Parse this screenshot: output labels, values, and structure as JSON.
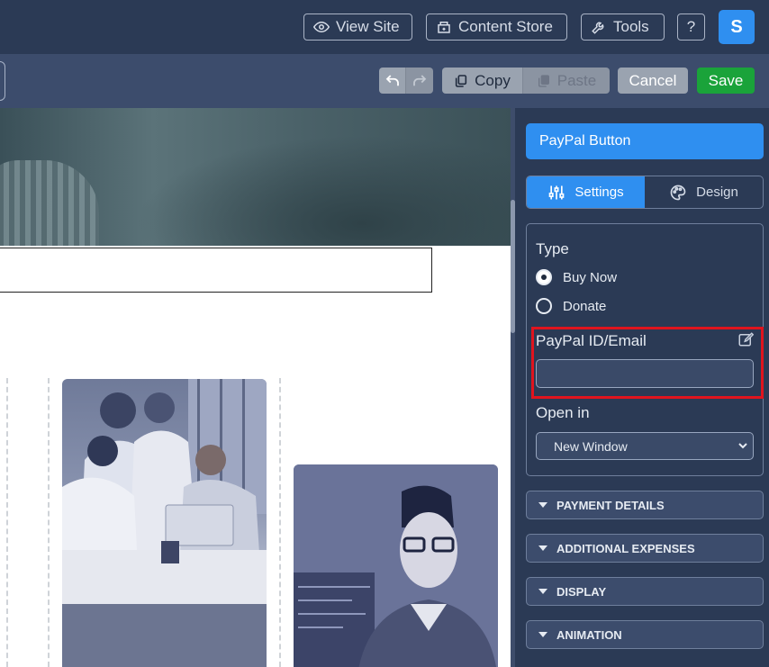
{
  "topbar": {
    "view_site": "View Site",
    "content_store": "Content Store",
    "tools": "Tools",
    "help": "?",
    "avatar_letter": "S"
  },
  "toolbar": {
    "copy": "Copy",
    "paste": "Paste",
    "cancel": "Cancel",
    "save": "Save"
  },
  "panel": {
    "title": "PayPal Button",
    "tabs": [
      "Settings",
      "Design"
    ],
    "type_label": "Type",
    "type_options": [
      "Buy Now",
      "Donate"
    ],
    "type_selected": "Buy Now",
    "paypal_label": "PayPal ID/Email",
    "paypal_value": "",
    "open_in_label": "Open in",
    "open_in_value": "New Window",
    "sections": [
      "PAYMENT DETAILS",
      "ADDITIONAL EXPENSES",
      "DISPLAY",
      "ANIMATION"
    ]
  },
  "colors": {
    "accent": "#2f8ff0",
    "save": "#1aa33a",
    "highlight": "#e0141e",
    "panel_bg": "#2b3a55"
  }
}
